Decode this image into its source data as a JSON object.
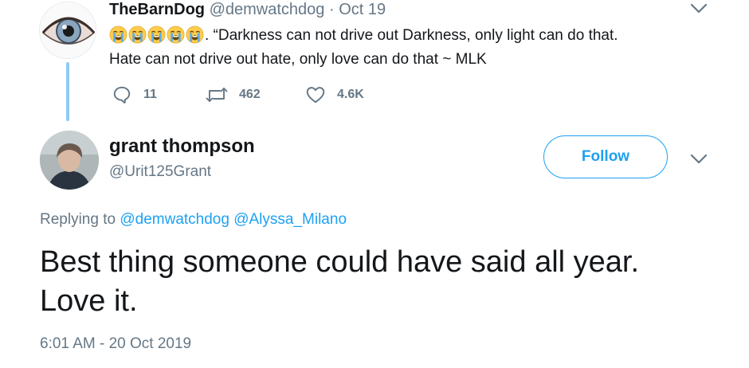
{
  "parent_tweet": {
    "display_name": "TheBarnDog",
    "handle": "@demwatchdog",
    "separator": "·",
    "date": "Oct 19",
    "emoji_count": 5,
    "text_line1": ". “Darkness can not  drive out Darkness, only light can do that.",
    "text_line2": "Hate can not drive out hate, only love can do that ~ MLK",
    "replies": "11",
    "retweets": "462",
    "likes": "4.6K"
  },
  "main_tweet": {
    "display_name": "grant thompson",
    "handle": "@Urit125Grant",
    "follow_label": "Follow",
    "replying_prefix": "Replying to",
    "mention_1": "@demwatchdog",
    "mention_2": "@Alyssa_Milano",
    "text_line1": "Best thing someone could have said all year.",
    "text_line2": "Love it.",
    "timestamp": "6:01 AM - 20 Oct 2019"
  },
  "icons": {
    "menu_chevron": "chevron-down-icon",
    "reply": "reply-icon",
    "retweet": "retweet-icon",
    "like": "heart-icon",
    "emoji": "loudly-crying-face-emoji"
  },
  "colors": {
    "accent": "#1da1f2",
    "thread_line": "#8ecbf5",
    "muted_text": "#657786",
    "primary_text": "#14171a"
  }
}
